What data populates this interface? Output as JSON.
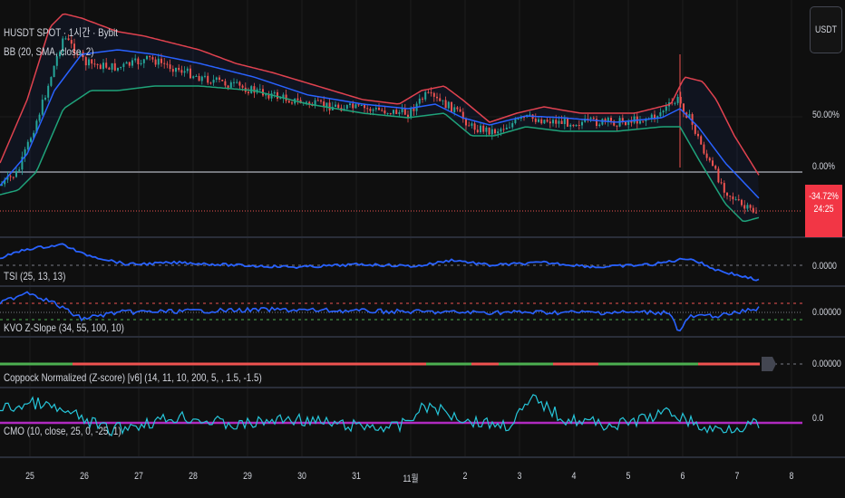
{
  "header": {
    "symbol_title": "HUSDT SPOT · 1시간 · Bybit",
    "bb_label": "BB (20, SMA, close, 2)",
    "currency_button": "USDT"
  },
  "price_axis": {
    "pct_50": "50.00%",
    "pct_0": "0.00%",
    "current_change": "-34.72%",
    "countdown": "24:25"
  },
  "indicators": {
    "tsi": {
      "label": "TSI (25, 13, 13)",
      "value": "0.0000"
    },
    "kvo": {
      "label": "KVO Z-Slope (34, 55, 100, 10)",
      "value": "0.00000"
    },
    "coppock": {
      "label": "Coppock Normalized (Z-score) [v6] (14, 11, 10, 200, 5, , 1.5, -1.5)",
      "value": "0.00000"
    },
    "cmo": {
      "label": "CMO (10, close, 25, 0, -25, 1)",
      "value": "0.0"
    }
  },
  "time_axis": [
    "25",
    "26",
    "27",
    "28",
    "29",
    "30",
    "31",
    "11월",
    "2",
    "3",
    "4",
    "5",
    "6",
    "7",
    "8"
  ],
  "colors": {
    "up": "#26a69a",
    "down": "#ef5350",
    "bb_upper": "#e0424f",
    "bb_basis": "#2962ff",
    "bb_lower": "#1fa37a",
    "cmo": "#26c6da",
    "cmo_mid": "#b02ac0",
    "badge": "#f23645"
  }
}
